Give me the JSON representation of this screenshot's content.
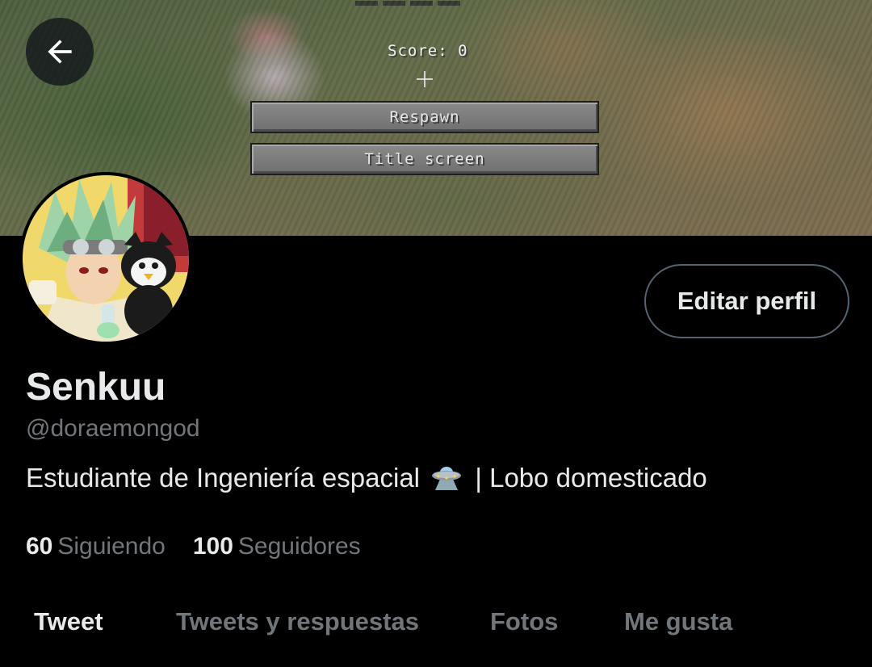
{
  "banner": {
    "score_text": "Score: 0",
    "respawn_label": "Respawn",
    "title_screen_label": "Title screen"
  },
  "header": {
    "back_icon": "arrow-left-icon"
  },
  "profile": {
    "display_name": "Senkuu",
    "handle": "@doraemongod",
    "bio_before": "Estudiante de Ingeniería espacial",
    "bio_emoji": "ufo-emoji",
    "bio_after": "| Lobo domesticado",
    "edit_label": "Editar perfil"
  },
  "stats": {
    "following_count": "60",
    "following_label": "Siguiendo",
    "followers_count": "100",
    "followers_label": "Seguidores"
  },
  "tabs": [
    {
      "label": "Tweet",
      "active": true
    },
    {
      "label": "Tweets y respuestas",
      "active": false
    },
    {
      "label": "Fotos",
      "active": false
    },
    {
      "label": "Me gusta",
      "active": false
    }
  ],
  "colors": {
    "background": "#000000",
    "primary_text": "#e7e9ea",
    "secondary_text": "#71767b",
    "button_border": "#536471"
  }
}
